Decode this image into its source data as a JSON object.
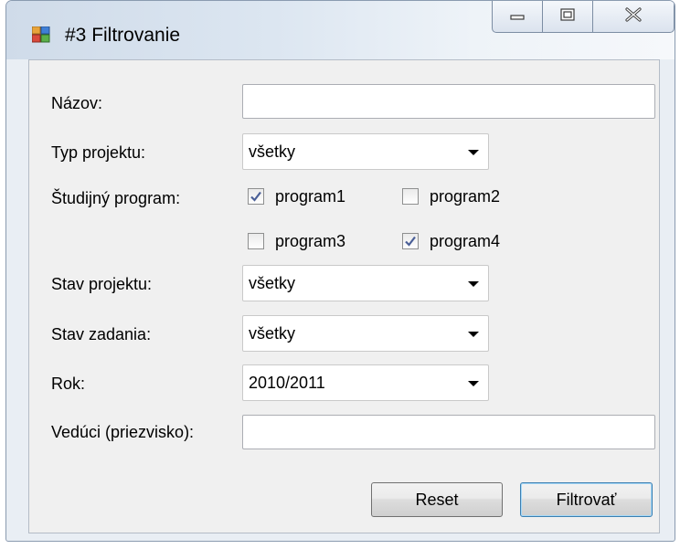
{
  "window": {
    "title": "#3 Filtrovanie"
  },
  "fields": {
    "name": {
      "label": "Názov:",
      "value": ""
    },
    "project_type": {
      "label": "Typ projektu:",
      "selected": "všetky"
    },
    "study_program": {
      "label": "Študijný program:",
      "options": [
        {
          "label": "program1",
          "checked": true
        },
        {
          "label": "program2",
          "checked": false
        },
        {
          "label": "program3",
          "checked": false
        },
        {
          "label": "program4",
          "checked": true
        }
      ]
    },
    "project_state": {
      "label": "Stav projektu:",
      "selected": "všetky"
    },
    "assignment_state": {
      "label": "Stav zadania:",
      "selected": "všetky"
    },
    "year": {
      "label": "Rok:",
      "selected": "2010/2011"
    },
    "supervisor": {
      "label": "Vedúci (priezvisko):",
      "value": ""
    }
  },
  "buttons": {
    "reset": "Reset",
    "filter": "Filtrovať"
  },
  "icons": {
    "app": "form-app-icon",
    "minimize": "minimize-icon",
    "maximize": "maximize-icon",
    "close": "close-icon"
  }
}
